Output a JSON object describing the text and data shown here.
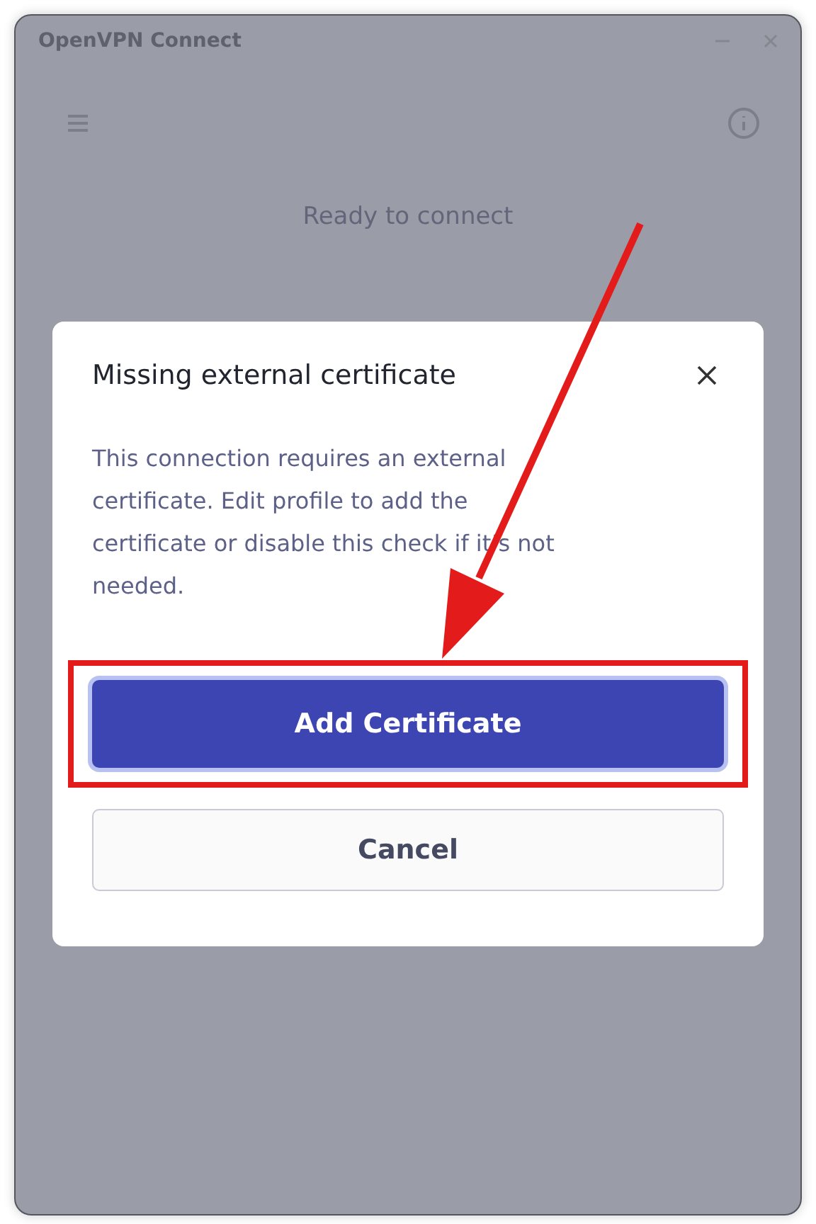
{
  "window": {
    "title": "OpenVPN Connect"
  },
  "status": "Ready to connect",
  "dialog": {
    "title": "Missing external certificate",
    "message": "This connection requires an external certificate. Edit profile to add the certificate or disable this check if it’s not needed.",
    "buttons": [
      {
        "label": "Add Certificate",
        "kind": "primary",
        "highlighted": true
      },
      {
        "label": "Cancel",
        "kind": "secondary",
        "highlighted": false
      }
    ]
  }
}
